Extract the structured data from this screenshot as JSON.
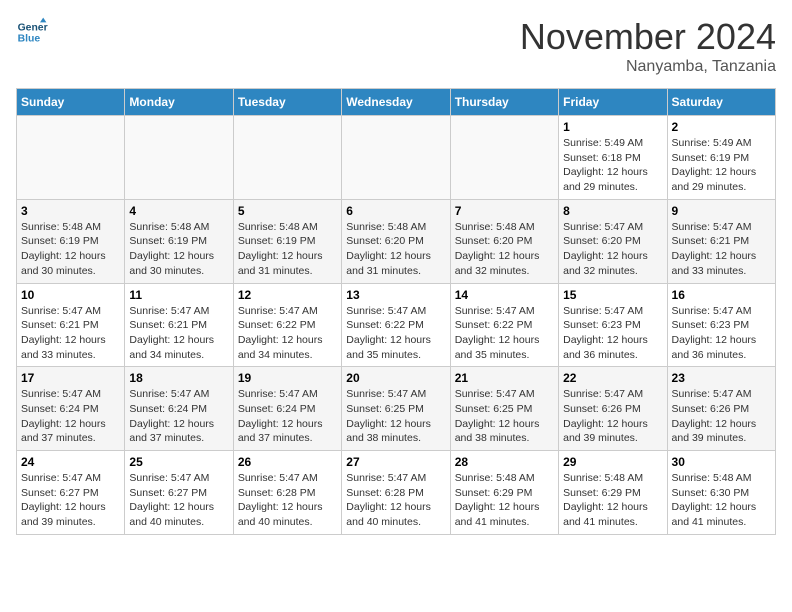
{
  "header": {
    "logo_line1": "General",
    "logo_line2": "Blue",
    "month": "November 2024",
    "location": "Nanyamba, Tanzania"
  },
  "weekdays": [
    "Sunday",
    "Monday",
    "Tuesday",
    "Wednesday",
    "Thursday",
    "Friday",
    "Saturday"
  ],
  "weeks": [
    [
      {
        "day": "",
        "info": ""
      },
      {
        "day": "",
        "info": ""
      },
      {
        "day": "",
        "info": ""
      },
      {
        "day": "",
        "info": ""
      },
      {
        "day": "",
        "info": ""
      },
      {
        "day": "1",
        "info": "Sunrise: 5:49 AM\nSunset: 6:18 PM\nDaylight: 12 hours and 29 minutes."
      },
      {
        "day": "2",
        "info": "Sunrise: 5:49 AM\nSunset: 6:19 PM\nDaylight: 12 hours and 29 minutes."
      }
    ],
    [
      {
        "day": "3",
        "info": "Sunrise: 5:48 AM\nSunset: 6:19 PM\nDaylight: 12 hours and 30 minutes."
      },
      {
        "day": "4",
        "info": "Sunrise: 5:48 AM\nSunset: 6:19 PM\nDaylight: 12 hours and 30 minutes."
      },
      {
        "day": "5",
        "info": "Sunrise: 5:48 AM\nSunset: 6:19 PM\nDaylight: 12 hours and 31 minutes."
      },
      {
        "day": "6",
        "info": "Sunrise: 5:48 AM\nSunset: 6:20 PM\nDaylight: 12 hours and 31 minutes."
      },
      {
        "day": "7",
        "info": "Sunrise: 5:48 AM\nSunset: 6:20 PM\nDaylight: 12 hours and 32 minutes."
      },
      {
        "day": "8",
        "info": "Sunrise: 5:47 AM\nSunset: 6:20 PM\nDaylight: 12 hours and 32 minutes."
      },
      {
        "day": "9",
        "info": "Sunrise: 5:47 AM\nSunset: 6:21 PM\nDaylight: 12 hours and 33 minutes."
      }
    ],
    [
      {
        "day": "10",
        "info": "Sunrise: 5:47 AM\nSunset: 6:21 PM\nDaylight: 12 hours and 33 minutes."
      },
      {
        "day": "11",
        "info": "Sunrise: 5:47 AM\nSunset: 6:21 PM\nDaylight: 12 hours and 34 minutes."
      },
      {
        "day": "12",
        "info": "Sunrise: 5:47 AM\nSunset: 6:22 PM\nDaylight: 12 hours and 34 minutes."
      },
      {
        "day": "13",
        "info": "Sunrise: 5:47 AM\nSunset: 6:22 PM\nDaylight: 12 hours and 35 minutes."
      },
      {
        "day": "14",
        "info": "Sunrise: 5:47 AM\nSunset: 6:22 PM\nDaylight: 12 hours and 35 minutes."
      },
      {
        "day": "15",
        "info": "Sunrise: 5:47 AM\nSunset: 6:23 PM\nDaylight: 12 hours and 36 minutes."
      },
      {
        "day": "16",
        "info": "Sunrise: 5:47 AM\nSunset: 6:23 PM\nDaylight: 12 hours and 36 minutes."
      }
    ],
    [
      {
        "day": "17",
        "info": "Sunrise: 5:47 AM\nSunset: 6:24 PM\nDaylight: 12 hours and 37 minutes."
      },
      {
        "day": "18",
        "info": "Sunrise: 5:47 AM\nSunset: 6:24 PM\nDaylight: 12 hours and 37 minutes."
      },
      {
        "day": "19",
        "info": "Sunrise: 5:47 AM\nSunset: 6:24 PM\nDaylight: 12 hours and 37 minutes."
      },
      {
        "day": "20",
        "info": "Sunrise: 5:47 AM\nSunset: 6:25 PM\nDaylight: 12 hours and 38 minutes."
      },
      {
        "day": "21",
        "info": "Sunrise: 5:47 AM\nSunset: 6:25 PM\nDaylight: 12 hours and 38 minutes."
      },
      {
        "day": "22",
        "info": "Sunrise: 5:47 AM\nSunset: 6:26 PM\nDaylight: 12 hours and 39 minutes."
      },
      {
        "day": "23",
        "info": "Sunrise: 5:47 AM\nSunset: 6:26 PM\nDaylight: 12 hours and 39 minutes."
      }
    ],
    [
      {
        "day": "24",
        "info": "Sunrise: 5:47 AM\nSunset: 6:27 PM\nDaylight: 12 hours and 39 minutes."
      },
      {
        "day": "25",
        "info": "Sunrise: 5:47 AM\nSunset: 6:27 PM\nDaylight: 12 hours and 40 minutes."
      },
      {
        "day": "26",
        "info": "Sunrise: 5:47 AM\nSunset: 6:28 PM\nDaylight: 12 hours and 40 minutes."
      },
      {
        "day": "27",
        "info": "Sunrise: 5:47 AM\nSunset: 6:28 PM\nDaylight: 12 hours and 40 minutes."
      },
      {
        "day": "28",
        "info": "Sunrise: 5:48 AM\nSunset: 6:29 PM\nDaylight: 12 hours and 41 minutes."
      },
      {
        "day": "29",
        "info": "Sunrise: 5:48 AM\nSunset: 6:29 PM\nDaylight: 12 hours and 41 minutes."
      },
      {
        "day": "30",
        "info": "Sunrise: 5:48 AM\nSunset: 6:30 PM\nDaylight: 12 hours and 41 minutes."
      }
    ]
  ]
}
